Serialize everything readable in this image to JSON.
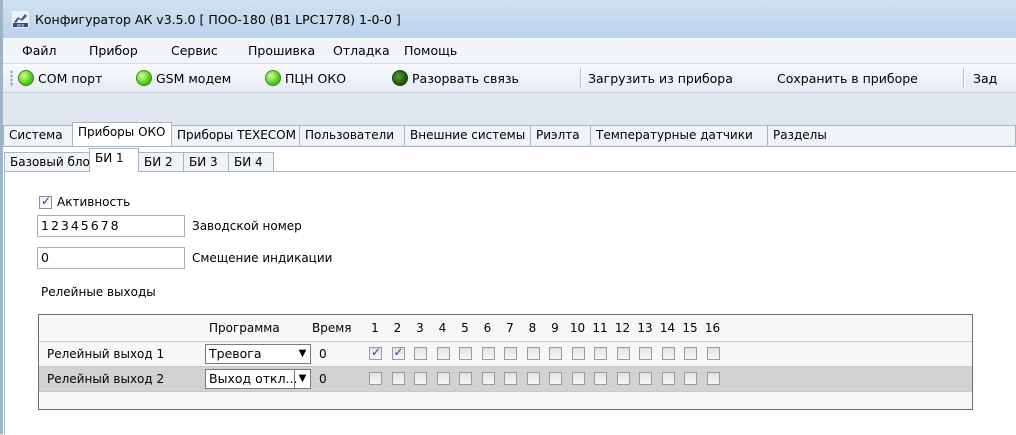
{
  "window": {
    "title": "Конфигуратор АК v3.5.0 [ ПОО-180 (В1 LPC1778) 1-0-0 ]",
    "icon": "app-icon"
  },
  "menu": [
    "Файл",
    "Прибор",
    "Сервис",
    "Прошивка",
    "Отладка",
    "Помощь"
  ],
  "toolbar": {
    "com": "COM порт",
    "gsm": "GSM модем",
    "pcn": "ПЦН ОКО",
    "disconnect": "Разорвать связь",
    "load": "Загрузить из прибора",
    "save": "Сохранить в приборе",
    "more": "Зад"
  },
  "main_tabs": [
    "Система",
    "Приборы ОКО",
    "Приборы ТЕХЕСОМ",
    "Пользователи",
    "Внешние системы",
    "Риэлта",
    "Температурные датчики",
    "Разделы"
  ],
  "main_tab_active": 1,
  "sub_tabs": [
    "Базовый блок",
    "БИ 1",
    "БИ 2",
    "БИ 3",
    "БИ 4"
  ],
  "sub_tab_active": 1,
  "form": {
    "activity_label": "Активность",
    "activity_checked": true,
    "serial_value": "12345678",
    "serial_label": "Заводской номер",
    "offset_value": "0",
    "offset_label": "Смещение индикации",
    "relays_title": "Релейные выходы"
  },
  "relay_table": {
    "col_program": "Программа",
    "col_time": "Время",
    "channels": [
      "1",
      "2",
      "3",
      "4",
      "5",
      "6",
      "7",
      "8",
      "9",
      "10",
      "11",
      "12",
      "13",
      "14",
      "15",
      "16"
    ],
    "rows": [
      {
        "name": "Релейный выход 1",
        "program": "Тревога",
        "time": "0",
        "checks": [
          true,
          true,
          false,
          false,
          false,
          false,
          false,
          false,
          false,
          false,
          false,
          false,
          false,
          false,
          false,
          false
        ]
      },
      {
        "name": "Релейный выход 2",
        "program": "Выход откл...",
        "time": "0",
        "checks": [
          false,
          false,
          false,
          false,
          false,
          false,
          false,
          false,
          false,
          false,
          false,
          false,
          false,
          false,
          false,
          false
        ]
      }
    ]
  }
}
